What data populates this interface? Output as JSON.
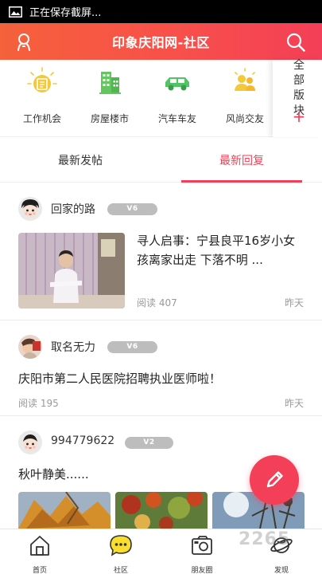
{
  "status_bar": {
    "text": "正在保存截屏..."
  },
  "header": {
    "title": "印象庆阳网-社区"
  },
  "categories": [
    {
      "label": "工作机会",
      "icon": "job-icon",
      "color": "#f0c230"
    },
    {
      "label": "房屋楼市",
      "icon": "building-icon",
      "color": "#5fc45c"
    },
    {
      "label": "汽车车友",
      "icon": "car-icon",
      "color": "#4cc062"
    },
    {
      "label": "风尚交友",
      "icon": "friends-icon",
      "color": "#f0c230"
    }
  ],
  "all_sections": {
    "label": "全部版块",
    "plus": "+"
  },
  "tabs": [
    {
      "label": "最新发帖",
      "active": false
    },
    {
      "label": "最新回复",
      "active": true
    }
  ],
  "posts": [
    {
      "author": "回家的路",
      "level": "V6",
      "title": "寻人启事：宁县良平16岁小女孩离家出走 下落不明 ...",
      "reads": "阅读 407",
      "time": "昨天"
    },
    {
      "author": "取名无力",
      "level": "V6",
      "title": "庆阳市第二人民医院招聘执业医师啦！",
      "reads": "阅读 195",
      "time": "昨天"
    },
    {
      "author": "994779622",
      "level": "V2",
      "title": "秋叶静美......"
    }
  ],
  "bottom_nav": [
    {
      "label": "首页",
      "icon": "home-icon"
    },
    {
      "label": "社区",
      "icon": "community-icon"
    },
    {
      "label": "朋友圈",
      "icon": "moments-icon"
    },
    {
      "label": "发现",
      "icon": "discover-icon"
    }
  ],
  "watermark": "2265"
}
